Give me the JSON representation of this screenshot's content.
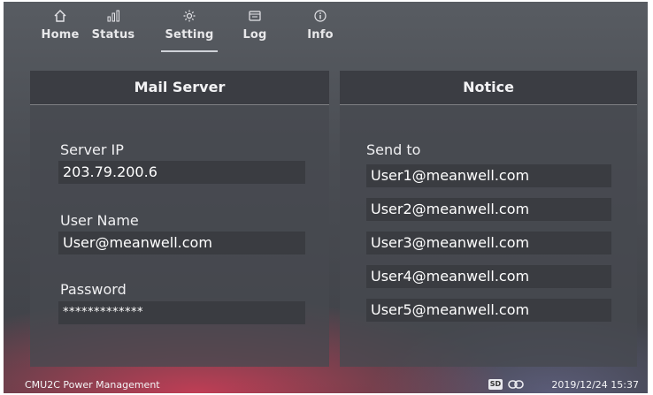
{
  "nav": {
    "items": [
      {
        "label": "Home",
        "icon": "home-icon"
      },
      {
        "label": "Status",
        "icon": "status-bars-icon"
      },
      {
        "label": "Setting",
        "icon": "gear-icon"
      },
      {
        "label": "Log",
        "icon": "log-icon"
      },
      {
        "label": "Info",
        "icon": "info-icon"
      }
    ],
    "active": "Setting"
  },
  "mail_server": {
    "title": "Mail Server",
    "server_ip_label": "Server IP",
    "server_ip_value": "203.79.200.6",
    "user_name_label": "User Name",
    "user_name_value": "User@meanwell.com",
    "password_label": "Password",
    "password_value": "*************"
  },
  "notice": {
    "title": "Notice",
    "send_to_label": "Send to",
    "recipients": [
      "User1@meanwell.com",
      "User2@meanwell.com",
      "User3@meanwell.com",
      "User4@meanwell.com",
      "User5@meanwell.com"
    ]
  },
  "status_bar": {
    "app_name": "CMU2C Power Management",
    "sd_label": "SD",
    "datetime": "2019/12/24 15:37"
  },
  "colors": {
    "field_bg": "#3a3c41",
    "glow": "#d63e58"
  }
}
